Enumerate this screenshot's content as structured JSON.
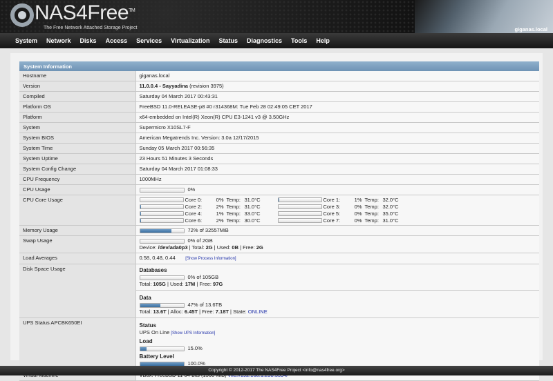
{
  "header": {
    "logo": "NAS4Free",
    "tm": "TM",
    "tagline": "The Free Network Attached Storage Project",
    "hostname": "giganas.local"
  },
  "nav": [
    "System",
    "Network",
    "Disks",
    "Access",
    "Services",
    "Virtualization",
    "Status",
    "Diagnostics",
    "Tools",
    "Help"
  ],
  "section_title": "System Information",
  "rows": {
    "hostname": {
      "label": "Hostname",
      "value": "giganas.local"
    },
    "version": {
      "label": "Version",
      "value": "11.0.0.4 - Sayyadina",
      "rev": "(revision 3975)"
    },
    "compiled": {
      "label": "Compiled",
      "value": "Saturday 04 March 2017 00:43:31"
    },
    "platform_os": {
      "label": "Platform OS",
      "value": "FreeBSD 11.0-RELEASE-p8 #0 r314368M: Tue Feb 28 02:49:05 CET 2017"
    },
    "platform": {
      "label": "Platform",
      "value": "x64-embedded on Intel(R) Xeon(R) CPU E3-1241 v3 @ 3.50GHz"
    },
    "system": {
      "label": "System",
      "value": "Supermicro X10SL7-F"
    },
    "bios": {
      "label": "System BIOS",
      "value": "American Megatrends Inc. Version: 3.0a 12/17/2015"
    },
    "time": {
      "label": "System Time",
      "value": "Sunday 05 March 2017 00:56:35"
    },
    "uptime": {
      "label": "System Uptime",
      "value": "23 Hours 51 Minutes 3 Seconds"
    },
    "config": {
      "label": "System Config Change",
      "value": "Saturday 04 March 2017 01:08:33"
    },
    "cpu_freq": {
      "label": "CPU Frequency",
      "value": "1000MHz"
    },
    "cpu_usage": {
      "label": "CPU Usage",
      "value": "0%",
      "percent": 0
    },
    "cores": {
      "label": "CPU Core Usage",
      "temp_label": "Temp:",
      "items": [
        {
          "name": "Core 0:",
          "usage": "0%",
          "percent": 0,
          "temp": "31.0°C"
        },
        {
          "name": "Core 1:",
          "usage": "1%",
          "percent": 1,
          "temp": "32.0°C"
        },
        {
          "name": "Core 2:",
          "usage": "2%",
          "percent": 2,
          "temp": "31.0°C"
        },
        {
          "name": "Core 3:",
          "usage": "0%",
          "percent": 0,
          "temp": "32.0°C"
        },
        {
          "name": "Core 4:",
          "usage": "1%",
          "percent": 1,
          "temp": "33.0°C"
        },
        {
          "name": "Core 5:",
          "usage": "0%",
          "percent": 0,
          "temp": "35.0°C"
        },
        {
          "name": "Core 6:",
          "usage": "2%",
          "percent": 2,
          "temp": "30.0°C"
        },
        {
          "name": "Core 7:",
          "usage": "0%",
          "percent": 0,
          "temp": "31.0°C"
        }
      ]
    },
    "memory": {
      "label": "Memory Usage",
      "value": "72% of 32557MiB",
      "percent": 72
    },
    "swap": {
      "label": "Swap Usage",
      "value": "0% of 2GB",
      "percent": 0,
      "device_label": "Device:",
      "device": "/dev/ada0p3",
      "total_label": "Total:",
      "total": "2G",
      "used_label": "Used:",
      "used": "0B",
      "free_label": "Free:",
      "free": "2G"
    },
    "load": {
      "label": "Load Averages",
      "value": "0.58, 0.48, 0.44",
      "link": "[Show Process Information]"
    },
    "disk": {
      "label": "Disk Space Usage",
      "pools": [
        {
          "name": "Databases",
          "value": "0% of 105GB",
          "percent": 0,
          "total": "105G",
          "used_label": "Used:",
          "used": "17M",
          "free": "97G"
        },
        {
          "name": "Data",
          "value": "47% of 13.6TB",
          "percent": 47,
          "total": "13.6T",
          "used_label": "Alloc:",
          "used": "6.45T",
          "free": "7.18T",
          "state_label": "State:",
          "state": "ONLINE"
        }
      ],
      "total_label": "Total:",
      "free_label": "Free:"
    },
    "ups": {
      "label": "UPS Status APCBK650EI",
      "status_title": "Status",
      "status": "UPS On Line",
      "link": "[Show UPS Information]",
      "load_title": "Load",
      "load": "15.0%",
      "load_percent": 15,
      "battery_title": "Battery Level",
      "battery": "100.0%",
      "battery_percent": 100
    },
    "vm": {
      "label": "Virtual Machine",
      "value": "VBox: FreeBSD 11 64-bits (1500 MiB)",
      "link": "vnc://192.168.1.238:3394/"
    }
  },
  "footer": "Copyright © 2012-2017 The NAS4Free Project <info@nas4free.org>"
}
